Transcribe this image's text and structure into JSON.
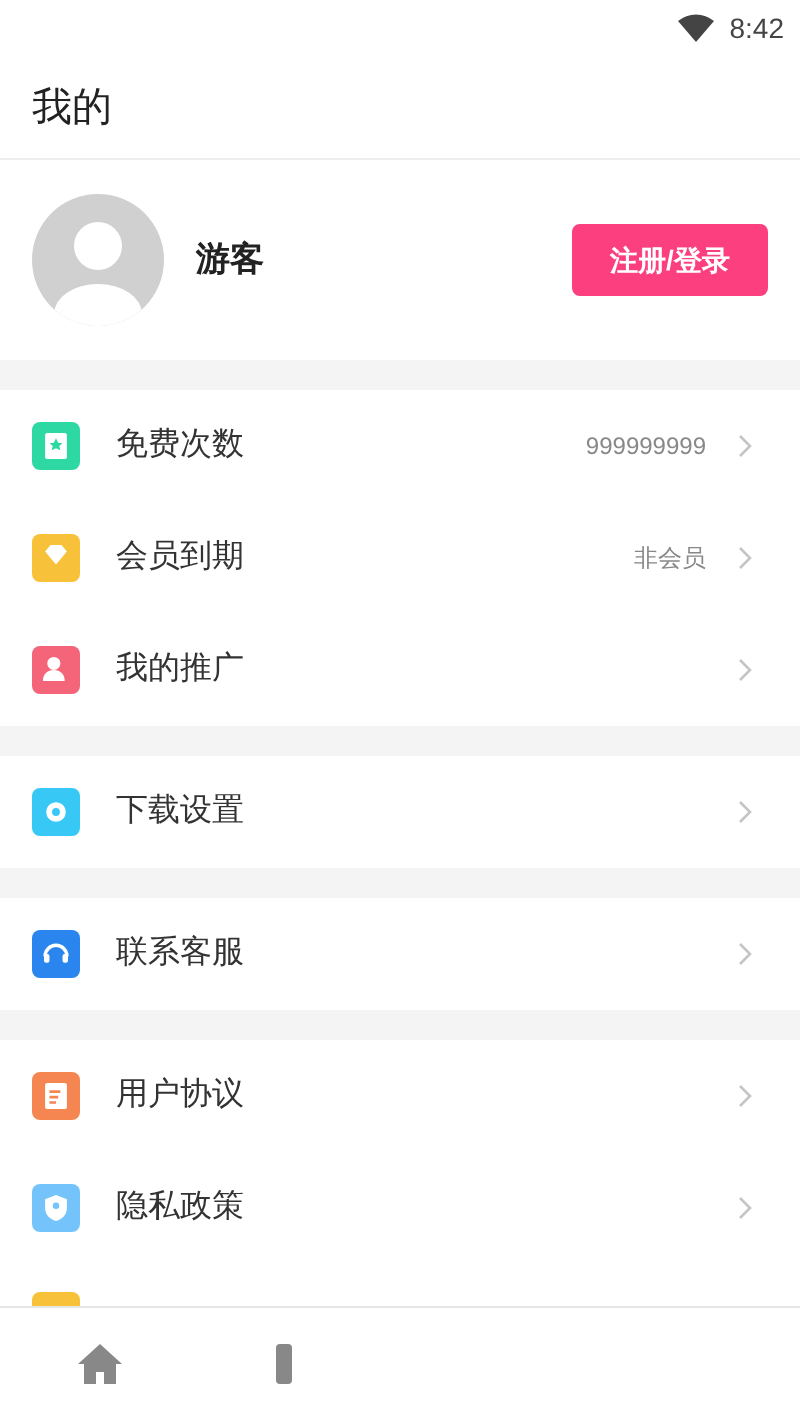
{
  "status_bar": {
    "time": "8:42"
  },
  "header": {
    "title": "我的"
  },
  "profile": {
    "name": "游客",
    "login_button": "注册/登录"
  },
  "sections": [
    {
      "items": [
        {
          "label": "免费次数",
          "value": "999999999"
        },
        {
          "label": "会员到期",
          "value": "非会员"
        },
        {
          "label": "我的推广"
        }
      ]
    },
    {
      "items": [
        {
          "label": "下载设置"
        }
      ]
    },
    {
      "items": [
        {
          "label": "联系客服"
        }
      ]
    },
    {
      "items": [
        {
          "label": "用户协议"
        },
        {
          "label": "隐私政策"
        }
      ]
    }
  ]
}
